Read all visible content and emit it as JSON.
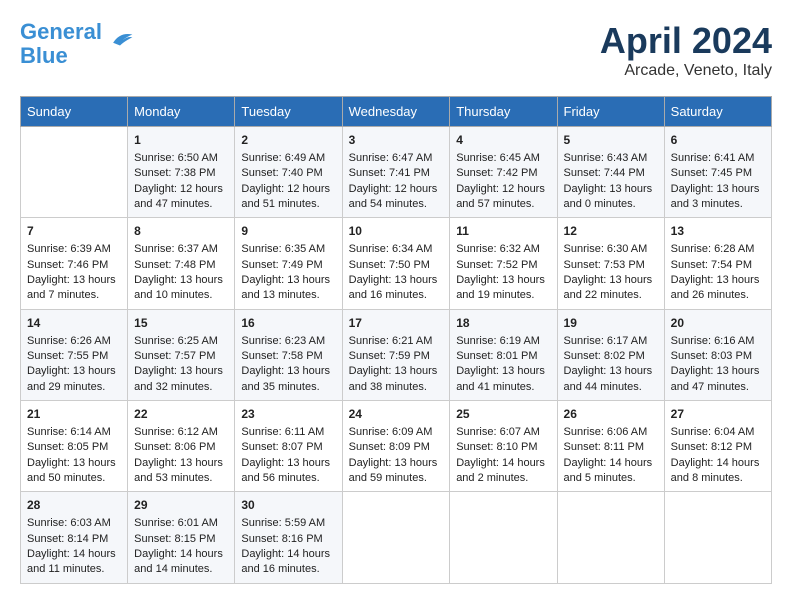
{
  "header": {
    "logo_line1": "General",
    "logo_line2": "Blue",
    "month": "April 2024",
    "location": "Arcade, Veneto, Italy"
  },
  "days_of_week": [
    "Sunday",
    "Monday",
    "Tuesday",
    "Wednesday",
    "Thursday",
    "Friday",
    "Saturday"
  ],
  "weeks": [
    [
      {
        "day": "",
        "sunrise": "",
        "sunset": "",
        "daylight": ""
      },
      {
        "day": "1",
        "sunrise": "Sunrise: 6:50 AM",
        "sunset": "Sunset: 7:38 PM",
        "daylight": "Daylight: 12 hours and 47 minutes."
      },
      {
        "day": "2",
        "sunrise": "Sunrise: 6:49 AM",
        "sunset": "Sunset: 7:40 PM",
        "daylight": "Daylight: 12 hours and 51 minutes."
      },
      {
        "day": "3",
        "sunrise": "Sunrise: 6:47 AM",
        "sunset": "Sunset: 7:41 PM",
        "daylight": "Daylight: 12 hours and 54 minutes."
      },
      {
        "day": "4",
        "sunrise": "Sunrise: 6:45 AM",
        "sunset": "Sunset: 7:42 PM",
        "daylight": "Daylight: 12 hours and 57 minutes."
      },
      {
        "day": "5",
        "sunrise": "Sunrise: 6:43 AM",
        "sunset": "Sunset: 7:44 PM",
        "daylight": "Daylight: 13 hours and 0 minutes."
      },
      {
        "day": "6",
        "sunrise": "Sunrise: 6:41 AM",
        "sunset": "Sunset: 7:45 PM",
        "daylight": "Daylight: 13 hours and 3 minutes."
      }
    ],
    [
      {
        "day": "7",
        "sunrise": "Sunrise: 6:39 AM",
        "sunset": "Sunset: 7:46 PM",
        "daylight": "Daylight: 13 hours and 7 minutes."
      },
      {
        "day": "8",
        "sunrise": "Sunrise: 6:37 AM",
        "sunset": "Sunset: 7:48 PM",
        "daylight": "Daylight: 13 hours and 10 minutes."
      },
      {
        "day": "9",
        "sunrise": "Sunrise: 6:35 AM",
        "sunset": "Sunset: 7:49 PM",
        "daylight": "Daylight: 13 hours and 13 minutes."
      },
      {
        "day": "10",
        "sunrise": "Sunrise: 6:34 AM",
        "sunset": "Sunset: 7:50 PM",
        "daylight": "Daylight: 13 hours and 16 minutes."
      },
      {
        "day": "11",
        "sunrise": "Sunrise: 6:32 AM",
        "sunset": "Sunset: 7:52 PM",
        "daylight": "Daylight: 13 hours and 19 minutes."
      },
      {
        "day": "12",
        "sunrise": "Sunrise: 6:30 AM",
        "sunset": "Sunset: 7:53 PM",
        "daylight": "Daylight: 13 hours and 22 minutes."
      },
      {
        "day": "13",
        "sunrise": "Sunrise: 6:28 AM",
        "sunset": "Sunset: 7:54 PM",
        "daylight": "Daylight: 13 hours and 26 minutes."
      }
    ],
    [
      {
        "day": "14",
        "sunrise": "Sunrise: 6:26 AM",
        "sunset": "Sunset: 7:55 PM",
        "daylight": "Daylight: 13 hours and 29 minutes."
      },
      {
        "day": "15",
        "sunrise": "Sunrise: 6:25 AM",
        "sunset": "Sunset: 7:57 PM",
        "daylight": "Daylight: 13 hours and 32 minutes."
      },
      {
        "day": "16",
        "sunrise": "Sunrise: 6:23 AM",
        "sunset": "Sunset: 7:58 PM",
        "daylight": "Daylight: 13 hours and 35 minutes."
      },
      {
        "day": "17",
        "sunrise": "Sunrise: 6:21 AM",
        "sunset": "Sunset: 7:59 PM",
        "daylight": "Daylight: 13 hours and 38 minutes."
      },
      {
        "day": "18",
        "sunrise": "Sunrise: 6:19 AM",
        "sunset": "Sunset: 8:01 PM",
        "daylight": "Daylight: 13 hours and 41 minutes."
      },
      {
        "day": "19",
        "sunrise": "Sunrise: 6:17 AM",
        "sunset": "Sunset: 8:02 PM",
        "daylight": "Daylight: 13 hours and 44 minutes."
      },
      {
        "day": "20",
        "sunrise": "Sunrise: 6:16 AM",
        "sunset": "Sunset: 8:03 PM",
        "daylight": "Daylight: 13 hours and 47 minutes."
      }
    ],
    [
      {
        "day": "21",
        "sunrise": "Sunrise: 6:14 AM",
        "sunset": "Sunset: 8:05 PM",
        "daylight": "Daylight: 13 hours and 50 minutes."
      },
      {
        "day": "22",
        "sunrise": "Sunrise: 6:12 AM",
        "sunset": "Sunset: 8:06 PM",
        "daylight": "Daylight: 13 hours and 53 minutes."
      },
      {
        "day": "23",
        "sunrise": "Sunrise: 6:11 AM",
        "sunset": "Sunset: 8:07 PM",
        "daylight": "Daylight: 13 hours and 56 minutes."
      },
      {
        "day": "24",
        "sunrise": "Sunrise: 6:09 AM",
        "sunset": "Sunset: 8:09 PM",
        "daylight": "Daylight: 13 hours and 59 minutes."
      },
      {
        "day": "25",
        "sunrise": "Sunrise: 6:07 AM",
        "sunset": "Sunset: 8:10 PM",
        "daylight": "Daylight: 14 hours and 2 minutes."
      },
      {
        "day": "26",
        "sunrise": "Sunrise: 6:06 AM",
        "sunset": "Sunset: 8:11 PM",
        "daylight": "Daylight: 14 hours and 5 minutes."
      },
      {
        "day": "27",
        "sunrise": "Sunrise: 6:04 AM",
        "sunset": "Sunset: 8:12 PM",
        "daylight": "Daylight: 14 hours and 8 minutes."
      }
    ],
    [
      {
        "day": "28",
        "sunrise": "Sunrise: 6:03 AM",
        "sunset": "Sunset: 8:14 PM",
        "daylight": "Daylight: 14 hours and 11 minutes."
      },
      {
        "day": "29",
        "sunrise": "Sunrise: 6:01 AM",
        "sunset": "Sunset: 8:15 PM",
        "daylight": "Daylight: 14 hours and 14 minutes."
      },
      {
        "day": "30",
        "sunrise": "Sunrise: 5:59 AM",
        "sunset": "Sunset: 8:16 PM",
        "daylight": "Daylight: 14 hours and 16 minutes."
      },
      {
        "day": "",
        "sunrise": "",
        "sunset": "",
        "daylight": ""
      },
      {
        "day": "",
        "sunrise": "",
        "sunset": "",
        "daylight": ""
      },
      {
        "day": "",
        "sunrise": "",
        "sunset": "",
        "daylight": ""
      },
      {
        "day": "",
        "sunrise": "",
        "sunset": "",
        "daylight": ""
      }
    ]
  ]
}
